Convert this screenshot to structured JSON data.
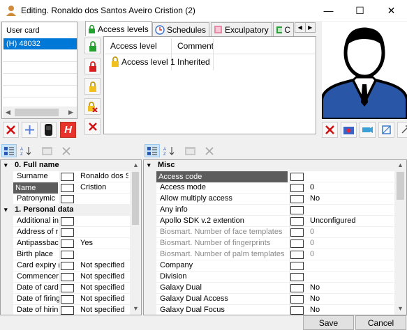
{
  "window": {
    "title": "Editing. Ronaldo dos Santos Aveiro Cristion (2)",
    "minimize": "—",
    "maximize": "☐",
    "close": "✕"
  },
  "user_card": {
    "header": "User card",
    "items": [
      "(H) 48032"
    ]
  },
  "card_toolbar": {
    "icons": [
      "delete-icon",
      "add-icon",
      "card-reader-icon",
      "hid-icon"
    ],
    "hid_label": "H"
  },
  "tabs": [
    {
      "label": "Access levels",
      "icon": "lock-icon",
      "active": true
    },
    {
      "label": "Schedules",
      "icon": "clock-icon",
      "active": false
    },
    {
      "label": "Exculpatory",
      "icon": "book-icon",
      "active": false
    },
    {
      "label": "C",
      "icon": "green-icon",
      "active": false
    }
  ],
  "access_table": {
    "columns": [
      "Access level",
      "Comment"
    ],
    "rows": [
      {
        "level": "Access level 1",
        "comment": "Inherited"
      }
    ]
  },
  "photo_toolbar": {
    "icons": [
      "delete-photo-icon",
      "camera-icon",
      "webcam-icon",
      "crop-icon",
      "rotate-icon"
    ]
  },
  "left_grid": {
    "rows": [
      {
        "type": "cat",
        "name": "0. Full name"
      },
      {
        "type": "prop",
        "name": "Surname",
        "value": "Ronaldo dos S"
      },
      {
        "type": "prop",
        "name": "Name",
        "value": "Cristion",
        "selected": true
      },
      {
        "type": "prop",
        "name": "Patronymic",
        "value": ""
      },
      {
        "type": "cat",
        "name": "1. Personal data"
      },
      {
        "type": "prop",
        "name": "Additional in",
        "value": ""
      },
      {
        "type": "prop",
        "name": "Address of r",
        "value": ""
      },
      {
        "type": "prop",
        "name": "Antipassbac",
        "value": "Yes"
      },
      {
        "type": "prop",
        "name": "Birth place",
        "value": ""
      },
      {
        "type": "prop",
        "name": "Card expiry (",
        "value": "Not specified"
      },
      {
        "type": "prop",
        "name": "Commencer",
        "value": "Not specified"
      },
      {
        "type": "prop",
        "name": "Date of card",
        "value": "Not specified"
      },
      {
        "type": "prop",
        "name": "Date of firing",
        "value": "Not specified"
      },
      {
        "type": "prop",
        "name": "Date of hirin",
        "value": "Not specified"
      }
    ]
  },
  "right_grid": {
    "rows": [
      {
        "type": "cat",
        "name": "Misc"
      },
      {
        "type": "prop",
        "name": "Access code",
        "value": "",
        "selected": true
      },
      {
        "type": "prop",
        "name": "Access mode",
        "value": "0"
      },
      {
        "type": "prop",
        "name": "Allow multiply access",
        "value": "No"
      },
      {
        "type": "prop",
        "name": "Any info",
        "value": ""
      },
      {
        "type": "prop",
        "name": "Apollo SDK v.2 extention",
        "value": "Unconfigured"
      },
      {
        "type": "prop",
        "name": "Biosmart. Number of face templates",
        "value": "0",
        "gray": true
      },
      {
        "type": "prop",
        "name": "Biosmart. Number of fingerprints",
        "value": "0",
        "gray": true
      },
      {
        "type": "prop",
        "name": "Biosmart. Number of palm templates",
        "value": "0",
        "gray": true
      },
      {
        "type": "prop",
        "name": "Company",
        "value": ""
      },
      {
        "type": "prop",
        "name": "Division",
        "value": ""
      },
      {
        "type": "prop",
        "name": "Galaxy Dual",
        "value": "No"
      },
      {
        "type": "prop",
        "name": "Galaxy Dual Access",
        "value": "No"
      },
      {
        "type": "prop",
        "name": "Galaxy Dual Focus",
        "value": "No"
      }
    ]
  },
  "footer": {
    "save": "Save",
    "cancel": "Cancel"
  }
}
